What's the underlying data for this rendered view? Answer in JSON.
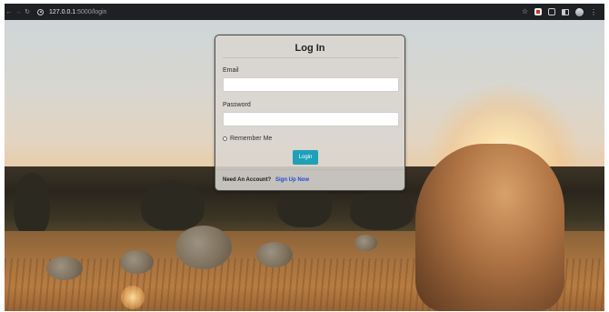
{
  "browser": {
    "url_host": "127.0.0.1",
    "url_path": ":5000/login",
    "nav_icons": [
      "back-arrow-icon",
      "forward-arrow-icon",
      "reload-icon"
    ],
    "toolbar_icons": [
      "bookmark-star-icon",
      "extension-icon",
      "extension-icon",
      "side-panel-icon",
      "profile-avatar-icon"
    ]
  },
  "login": {
    "title": "Log In",
    "email_label": "Email",
    "email_value": "",
    "password_label": "Password",
    "password_value": "",
    "remember_label": "Remember Me",
    "remember_checked": false,
    "login_button": "Login",
    "need_account_text": "Need An Account?",
    "signup_link": "Sign Up Now"
  },
  "colors": {
    "accent": "#1da1b9",
    "link": "#1a4fd6",
    "card_bg": "#dad6d0"
  }
}
